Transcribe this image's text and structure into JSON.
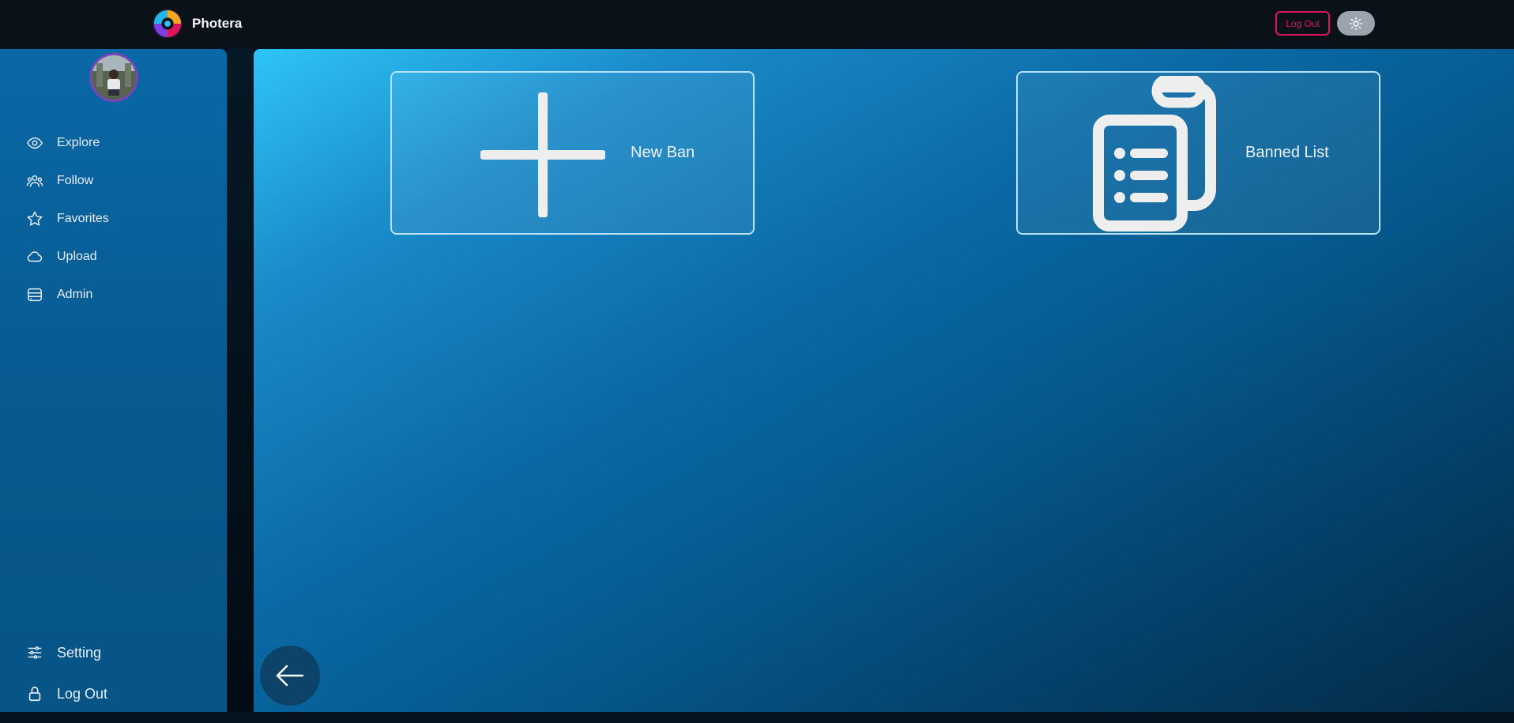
{
  "header": {
    "brand_name": "Photera",
    "logout_label": "Log Out",
    "theme_icon": "sun-icon"
  },
  "sidebar": {
    "avatar_icon": "user-avatar",
    "items": [
      {
        "label": "Explore",
        "icon": "eye-icon"
      },
      {
        "label": "Follow",
        "icon": "users-icon"
      },
      {
        "label": "Favorites",
        "icon": "star-icon"
      },
      {
        "label": "Upload",
        "icon": "cloud-icon"
      },
      {
        "label": "Admin",
        "icon": "database-icon"
      }
    ],
    "bottom_items": [
      {
        "label": "Setting",
        "icon": "sliders-icon"
      },
      {
        "label": "Log Out",
        "icon": "lock-icon"
      }
    ]
  },
  "main": {
    "cards": [
      {
        "label": "New Ban",
        "icon": "plus-icon"
      },
      {
        "label": "Banned List",
        "icon": "clipboard-list-icon"
      }
    ],
    "back_icon": "arrow-left-icon"
  },
  "colors": {
    "accent_red": "#e0145c",
    "sidebar_blue": "#0a68a6",
    "main_gradient_start": "#2ec4f7",
    "main_gradient_end": "#032a45"
  }
}
